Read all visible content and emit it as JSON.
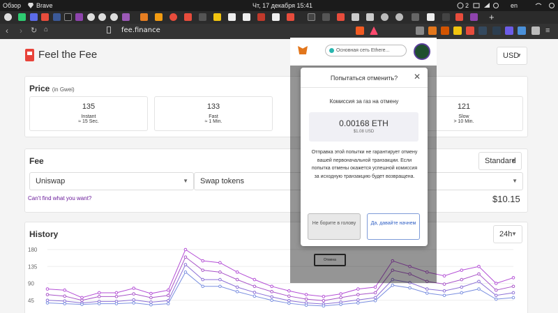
{
  "os": {
    "overview": "Обзор",
    "app": "Brave",
    "datetime": "Чт, 17 декабря  15:41",
    "notif": "2",
    "lang": "en"
  },
  "browser": {
    "url": "fee.finance"
  },
  "site": {
    "title": "Feel the Fee",
    "currency": "USD",
    "price": {
      "heading": "Price",
      "unit": "(in Gwei)",
      "boxes": [
        {
          "value": "135",
          "name": "Instant",
          "time": "≈ 15 Sec."
        },
        {
          "value": "133",
          "name": "Fast",
          "time": "≈ 1 Min."
        },
        {
          "value": "121",
          "name": "Slow",
          "time": "> 10 Min."
        }
      ]
    },
    "fee": {
      "heading": "Fee",
      "speed": "Standard",
      "platform": "Uniswap",
      "action": "Swap tokens",
      "cant_find": "Can't find what you want?",
      "value": "$10.15"
    },
    "history": {
      "heading": "History",
      "range": "24h",
      "y_ticks": [
        "180",
        "135",
        "90",
        "45"
      ]
    }
  },
  "metamask": {
    "network": "Основная сеть Ethere...",
    "modal": {
      "title": "Попытаться отменить?",
      "subtitle": "Комиссия за газ на отмену",
      "eth": "0.00168 ETH",
      "usd": "$1.08 USD",
      "body": "Отправка этой попытки не гарантирует отмену вашей первоначальной транзакции. Если попытка отмены окажется успешной комиссия за исходную транзакцию будет возвращена.",
      "cancel_btn": "Не борите в голову",
      "confirm_btn": "Да, давайте начнем"
    },
    "bg_button": "Отмена"
  },
  "chart_data": {
    "type": "line",
    "ylim": [
      0,
      180
    ],
    "y_ticks": [
      180,
      135,
      90,
      45
    ],
    "series": [
      {
        "values": [
          75,
          72,
          52,
          65,
          65,
          77,
          63,
          72,
          180,
          150,
          145,
          120,
          100,
          82,
          70,
          60,
          55,
          62,
          75,
          80,
          150,
          135,
          120,
          110,
          125,
          135,
          90,
          105
        ]
      },
      {
        "values": [
          60,
          56,
          45,
          55,
          55,
          62,
          52,
          58,
          160,
          125,
          120,
          100,
          82,
          68,
          56,
          48,
          44,
          52,
          60,
          65,
          125,
          115,
          95,
          88,
          100,
          115,
          72,
          82
        ]
      },
      {
        "values": [
          45,
          43,
          38,
          42,
          42,
          46,
          40,
          44,
          140,
          100,
          100,
          80,
          66,
          54,
          44,
          38,
          35,
          40,
          46,
          52,
          100,
          92,
          75,
          70,
          80,
          95,
          58,
          65
        ]
      },
      {
        "values": [
          38,
          36,
          34,
          36,
          36,
          38,
          33,
          36,
          120,
          82,
          82,
          68,
          56,
          45,
          37,
          32,
          30,
          34,
          38,
          44,
          85,
          78,
          64,
          58,
          65,
          75,
          48,
          52
        ]
      }
    ],
    "colors": [
      "#b44fd6",
      "#a854c8",
      "#8b6fd6",
      "#7a8fe0"
    ]
  }
}
